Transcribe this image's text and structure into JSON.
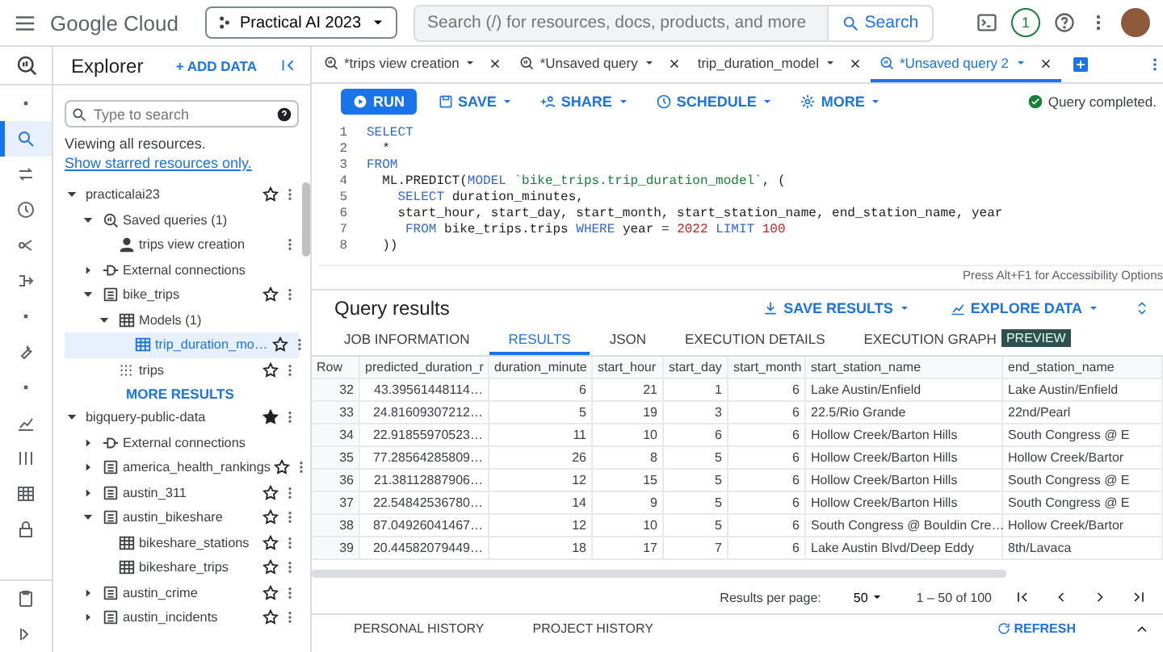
{
  "topbar": {
    "logo": "Google Cloud",
    "project": "Practical AI 2023",
    "search": {
      "placeholder": "Search (/) for resources, docs, products, and more"
    },
    "search_button": "Search",
    "notifications": "1"
  },
  "explorer": {
    "title": "Explorer",
    "add_data": "+ ADD DATA",
    "search": {
      "placeholder": "Type to search"
    },
    "note": "Viewing all resources.",
    "note_link": "Show starred resources only.",
    "tree": [
      {
        "kind": "project",
        "label": "practicalai23",
        "expanded": true,
        "starred": false,
        "children": [
          {
            "kind": "saved",
            "label": "Saved queries (1)",
            "expanded": true,
            "children": [
              {
                "kind": "query",
                "label": "trips view creation",
                "menu": true
              }
            ]
          },
          {
            "kind": "connections",
            "label": "External connections",
            "expanded": false
          },
          {
            "kind": "dataset",
            "label": "bike_trips",
            "expanded": true,
            "starred": false,
            "children": [
              {
                "kind": "models",
                "label": "Models (1)",
                "expanded": true,
                "children": [
                  {
                    "kind": "model",
                    "label": "trip_duration_mo…",
                    "starred": false,
                    "selected": true
                  }
                ]
              },
              {
                "kind": "table",
                "label": "trips",
                "starred": false,
                "selected": false
              }
            ]
          }
        ]
      },
      {
        "kind": "more",
        "label": "MORE RESULTS"
      },
      {
        "kind": "project",
        "label": "bigquery-public-data",
        "expanded": true,
        "starred": true,
        "children": [
          {
            "kind": "connections",
            "label": "External connections",
            "expanded": false
          },
          {
            "kind": "dataset",
            "label": "america_health_rankings",
            "expanded": false,
            "starred": false
          },
          {
            "kind": "dataset",
            "label": "austin_311",
            "expanded": false,
            "starred": false
          },
          {
            "kind": "dataset",
            "label": "austin_bikeshare",
            "expanded": true,
            "starred": false,
            "children": [
              {
                "kind": "grid",
                "label": "bikeshare_stations",
                "starred": false,
                "selected": false
              },
              {
                "kind": "grid",
                "label": "bikeshare_trips",
                "starred": false,
                "selected": false
              }
            ]
          },
          {
            "kind": "dataset",
            "label": "austin_crime",
            "expanded": false,
            "starred": false
          },
          {
            "kind": "dataset",
            "label": "austin_incidents",
            "expanded": false,
            "starred": false
          }
        ]
      }
    ]
  },
  "tabs": [
    {
      "label": "*trips view creation",
      "kind": "query",
      "selected": false
    },
    {
      "label": "*Unsaved query",
      "kind": "query",
      "selected": false
    },
    {
      "label": "trip_duration_model",
      "kind": "model",
      "selected": false
    },
    {
      "label": "*Unsaved query 2",
      "kind": "query",
      "selected": true
    }
  ],
  "toolbar": {
    "run": "RUN",
    "buttons": [
      {
        "label": "SAVE",
        "kind": "save"
      },
      {
        "label": "SHARE",
        "kind": "share"
      },
      {
        "label": "SCHEDULE",
        "kind": "schedule"
      },
      {
        "label": "MORE",
        "kind": "more"
      }
    ],
    "status": "Query completed."
  },
  "editor": {
    "lines": [
      {
        "number": "1",
        "tokens": [
          {
            "text": "SELECT",
            "kind": "keyword"
          }
        ]
      },
      {
        "number": "2",
        "tokens": [
          {
            "text": "  *",
            "kind": "plain"
          }
        ]
      },
      {
        "number": "3",
        "tokens": [
          {
            "text": "FROM",
            "kind": "keyword"
          }
        ]
      },
      {
        "number": "4",
        "tokens": [
          {
            "text": "  ML.PREDICT(",
            "kind": "plain"
          },
          {
            "text": "MODEL ",
            "kind": "keyword"
          },
          {
            "text": "`bike_trips.trip_duration_model`",
            "kind": "string"
          },
          {
            "text": ", (",
            "kind": "plain"
          }
        ]
      },
      {
        "number": "5",
        "tokens": [
          {
            "text": "    SELECT",
            "kind": "keyword"
          },
          {
            "text": " duration_minutes,",
            "kind": "plain"
          }
        ]
      },
      {
        "number": "6",
        "tokens": [
          {
            "text": "    start_hour, start_day, start_month, start_station_name, end_station_name, year",
            "kind": "plain"
          }
        ]
      },
      {
        "number": "7",
        "tokens": [
          {
            "text": "     FROM",
            "kind": "keyword"
          },
          {
            "text": " bike_trips.trips ",
            "kind": "plain"
          },
          {
            "text": "WHERE",
            "kind": "keyword"
          },
          {
            "text": " year = ",
            "kind": "plain"
          },
          {
            "text": "2022",
            "kind": "number"
          },
          {
            "text": " LIMIT ",
            "kind": "keyword"
          },
          {
            "text": "100",
            "kind": "number"
          }
        ]
      },
      {
        "number": "8",
        "tokens": [
          {
            "text": "  ))",
            "kind": "plain"
          }
        ]
      }
    ],
    "hint": "Press Alt+F1 for Accessibility Options"
  },
  "results": {
    "title": "Query results",
    "actions": [
      {
        "label": "SAVE RESULTS",
        "kind": "download"
      },
      {
        "label": "EXPLORE DATA",
        "kind": "chart"
      }
    ],
    "tabs": [
      {
        "label": "JOB INFORMATION",
        "selected": false
      },
      {
        "label": "RESULTS",
        "selected": true
      },
      {
        "label": "JSON",
        "selected": false
      },
      {
        "label": "EXECUTION DETAILS",
        "selected": false
      },
      {
        "label": "EXECUTION GRAPH",
        "badge": "PREVIEW",
        "selected": false
      }
    ],
    "table": {
      "columns": [
        "Row",
        "predicted_duration_r",
        "duration_minute",
        "start_hour",
        "start_day",
        "start_month",
        "start_station_name",
        "end_station_name"
      ],
      "rows": [
        [
          "32",
          "43.39561448114…",
          "6",
          "21",
          "1",
          "6",
          "Lake Austin/Enfield",
          "Lake Austin/Enfield"
        ],
        [
          "33",
          "24.81609307212…",
          "5",
          "19",
          "3",
          "6",
          "22.5/Rio Grande",
          "22nd/Pearl"
        ],
        [
          "34",
          "22.91855970523…",
          "11",
          "10",
          "6",
          "6",
          "Hollow Creek/Barton Hills",
          "South Congress @ E"
        ],
        [
          "35",
          "77.28564285809…",
          "26",
          "8",
          "5",
          "6",
          "Hollow Creek/Barton Hills",
          "Hollow Creek/Bartor"
        ],
        [
          "36",
          "21.38112887906…",
          "12",
          "15",
          "5",
          "6",
          "Hollow Creek/Barton Hills",
          "South Congress @ E"
        ],
        [
          "37",
          "22.54842536780…",
          "14",
          "9",
          "5",
          "6",
          "Hollow Creek/Barton Hills",
          "South Congress @ E"
        ],
        [
          "38",
          "87.04926041467…",
          "12",
          "10",
          "5",
          "6",
          "South Congress @ Bouldin Cre…",
          "Hollow Creek/Bartor"
        ],
        [
          "39",
          "20.44582079449…",
          "18",
          "17",
          "7",
          "6",
          "Lake Austin Blvd/Deep Eddy",
          "8th/Lavaca"
        ]
      ]
    },
    "pagination": {
      "label": "Results per page:",
      "per_page": "50",
      "range": "1 – 50 of 100"
    }
  },
  "history": {
    "tabs": [
      "PERSONAL HISTORY",
      "PROJECT HISTORY"
    ],
    "refresh": "REFRESH"
  }
}
